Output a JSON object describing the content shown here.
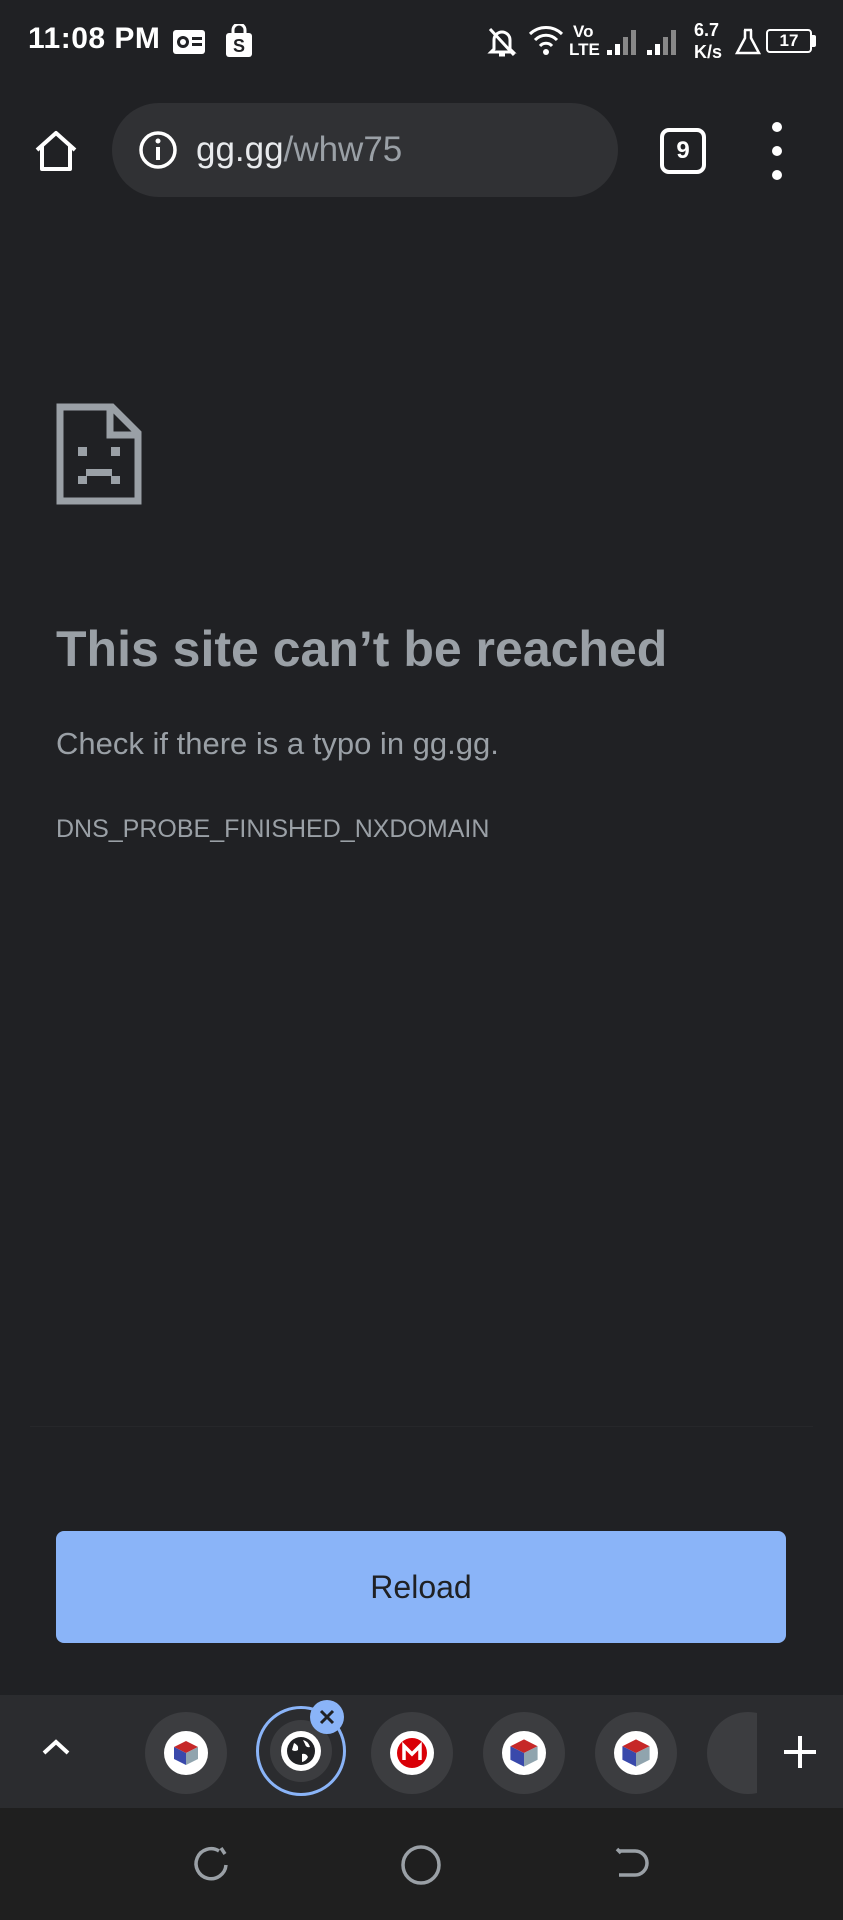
{
  "status_bar": {
    "time": "11:08 PM",
    "network_type_top": "Vo",
    "network_type_bottom": "LTE",
    "speed_value": "6.7",
    "speed_unit": "K/s",
    "battery": "17"
  },
  "toolbar": {
    "url_host": "gg.gg",
    "url_path": "/whw75",
    "tab_count": "9"
  },
  "error": {
    "title": "This site can’t be reached",
    "description": "Check if there is a typo in gg.gg.",
    "code": "DNS_PROBE_FINISHED_NXDOMAIN"
  },
  "reload": {
    "label": "Reload"
  },
  "colors": {
    "accent": "#8ab4f8",
    "background": "#202124"
  }
}
